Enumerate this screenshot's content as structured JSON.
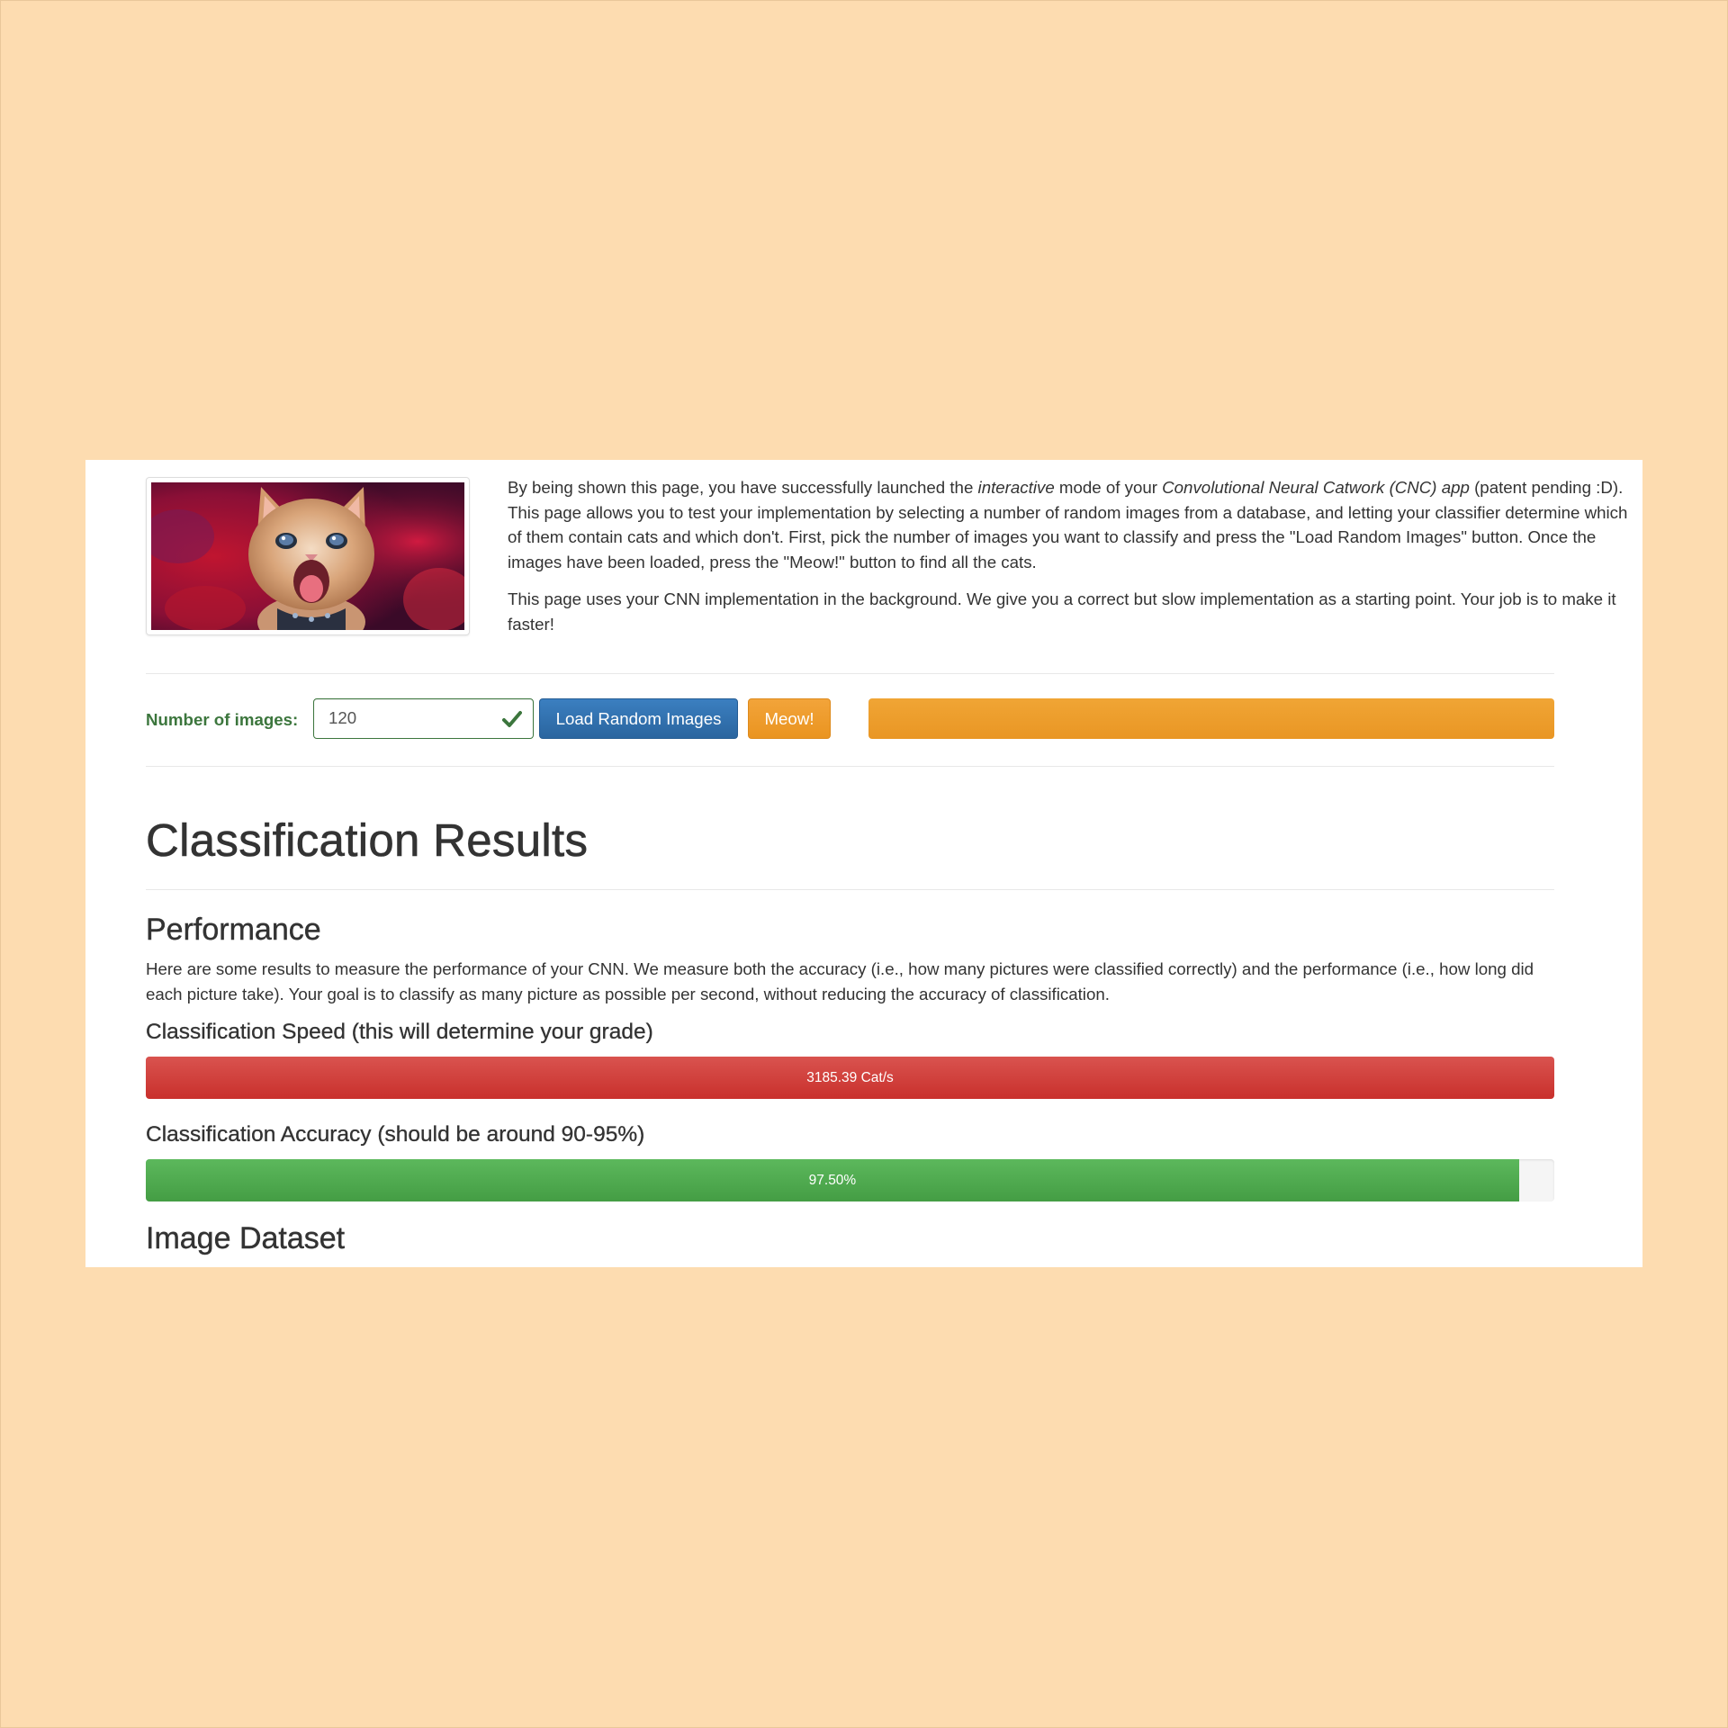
{
  "intro": {
    "p1_part1": "By being shown this page, you have successfully launched the ",
    "p1_em1": "interactive",
    "p1_part2": " mode of your ",
    "p1_em2": "Convolutional Neural Catwork (CNC) app",
    "p1_part3": " (patent pending :D). This page allows you to test your implementation by selecting a number of random images from a database, and letting your classifier determine which of them contain cats and which don't. First, pick the number of images you want to classify and press the \"Load Random Images\" button. Once the images have been loaded, press the \"Meow!\" button to find all the cats.",
    "p2": "This page uses your CNN implementation in the background. We give you a correct but slow implementation as a starting point. Your job is to make it faster!"
  },
  "controls": {
    "label": "Number of images:",
    "input_value": "120",
    "load_button": "Load Random Images",
    "meow_button": "Meow!",
    "progress_percent": 100
  },
  "results": {
    "title": "Classification Results",
    "performance": {
      "title": "Performance",
      "description": "Here are some results to measure the performance of your CNN. We measure both the accuracy (i.e., how many pictures were classified correctly) and the performance (i.e., how long did each picture take). Your goal is to classify as many picture as possible per second, without reducing the accuracy of classification.",
      "speed_label": "Classification Speed (this will determine your grade)",
      "speed_text": "3185.39 Cat/s",
      "speed_percent": 100,
      "accuracy_label": "Classification Accuracy (should be around 90-95%)",
      "accuracy_text": "97.50%",
      "accuracy_percent": 97.5
    },
    "dataset_title": "Image Dataset"
  },
  "colors": {
    "page_background": "#fddcb0",
    "success_green": "#3c763d",
    "primary_blue": "#2f6ea9",
    "warning_orange": "#ee9d2d",
    "danger_red": "#d9534f",
    "bar_green": "#5cb85c"
  }
}
